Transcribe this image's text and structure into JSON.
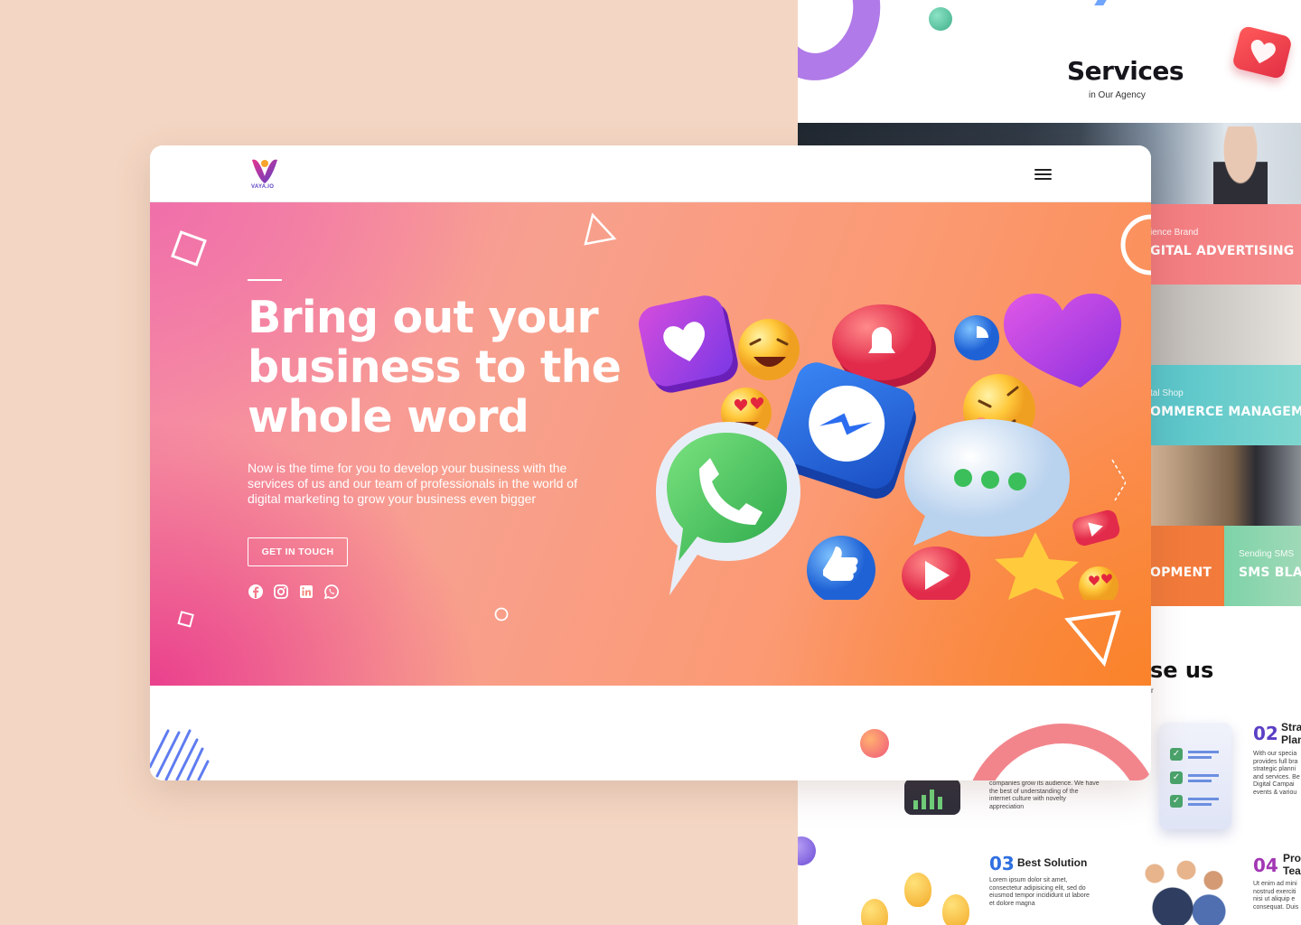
{
  "background_page": {
    "services_title": "Services",
    "services_subtitle": "in Our Agency",
    "tiles": [
      {
        "small": "ience Brand",
        "big": "GITAL ADVERTISING"
      },
      {
        "small": "tal Shop",
        "big": "OMMERCE MANAGEM"
      },
      {
        "small": "",
        "big": "OPMENT"
      },
      {
        "small": "Sending SMS",
        "big": "SMS BLA"
      }
    ],
    "choose_title": "se us",
    "choose_sub": "r",
    "features": [
      {
        "num": "02",
        "head_line1": "Stra",
        "head_line2": "Plan",
        "text": "With our specia\nprovides full bra\nstrategic planni\nand services. Be\nDigital Campai\nevents & variou"
      },
      {
        "num": "03",
        "head": "Best Solution",
        "text": "Lorem ipsum dolor sit amet,\nconsectetur adipisicing elit, sed do\neiusmod tempor incididunt ut labore\net dolore magna"
      },
      {
        "num": "04",
        "head_line1": "Pro",
        "head_line2": "Tea",
        "text": "Ut enim ad mini\nnostrud exerciti\nnisi ut aliquip e\nconsequat. Duis"
      }
    ],
    "partial_text": "companies grow its audience. We have\nthe best of understanding of the\ninternet culture with novelty\nappreciation"
  },
  "navbar": {
    "logo_text": "VAYA.IO",
    "menu_icon": "hamburger-menu-icon"
  },
  "hero": {
    "title": "Bring out your business to the whole word",
    "description": "Now is the time for you to develop your business with the services of us and our team of professionals in the world of digital marketing to grow your business even bigger",
    "cta_label": "GET IN TOUCH",
    "social_icons": [
      "facebook-icon",
      "instagram-icon",
      "linkedin-icon",
      "whatsapp-icon"
    ]
  },
  "colors": {
    "hero_pink": "#e93c8c",
    "hero_orange": "#fb8c4e",
    "page_background": "#f3d6c3",
    "brand_purple": "#5b3fc4"
  }
}
